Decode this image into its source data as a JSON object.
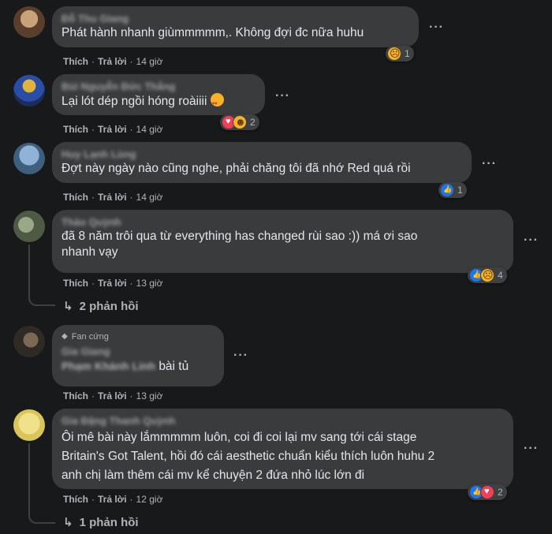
{
  "comments": [
    {
      "author": "Đỗ Thu Giang",
      "text": "Phát hành nhanh giùmmmmm,. Không đợi đc nữa huhu",
      "like": "Thích",
      "reply": "Trả lời",
      "time": "14 giờ",
      "reaction_count": "1",
      "reactions": [
        "sad"
      ]
    },
    {
      "author": "Bùi Nguyễn Đức Thắng",
      "text": "Lại lót dép ngồi hóng roàiiii",
      "like": "Thích",
      "reply": "Trả lời",
      "time": "14 giờ",
      "reaction_count": "2",
      "reactions": [
        "love",
        "haha"
      ]
    },
    {
      "author": "Huy Lạnh Lùng",
      "text": "Đợt này ngày nào cũng nghe, phải chăng tôi đã nhớ Red quá rồi",
      "like": "Thích",
      "reply": "Trả lời",
      "time": "14 giờ",
      "reaction_count": "1",
      "reactions": [
        "like"
      ]
    },
    {
      "author": "Thảo Quỳnh",
      "text_line1": "đã 8 năm trôi qua từ everything has changed rùi sao :)) má ơi sao",
      "text_line2": "nhanh vạy",
      "like": "Thích",
      "reply": "Trả lời",
      "time": "13 giờ",
      "reaction_count": "4",
      "reactions": [
        "like",
        "sad"
      ],
      "replies": "2 phản hồi"
    },
    {
      "badge": "Fan cứng",
      "author": "Gia Giang",
      "mention": "Phạm Khánh Linh",
      "text": "bài tủ",
      "like": "Thích",
      "reply": "Trả lời",
      "time": "13 giờ"
    },
    {
      "author": "Gia Đặng Thanh Quỳnh",
      "text_line1": "Ôi mê bài này lắmmmmm luôn, coi đi coi lại mv sang tới cái stage",
      "text_line2": "Britain's Got Talent, hồi đó cái aesthetic chuẩn kiểu thích luôn huhu 2",
      "text_line3": "anh chị làm thêm cái mv kể chuyện 2 đứa nhỏ lúc lớn đi",
      "like": "Thích",
      "reply": "Trả lời",
      "time": "12 giờ",
      "reaction_count": "2",
      "reactions": [
        "like",
        "love"
      ],
      "replies": "1 phản hồi"
    }
  ],
  "more_label": "···",
  "dot": "·",
  "reply_arrow": "↳",
  "gem_icon": "◆"
}
